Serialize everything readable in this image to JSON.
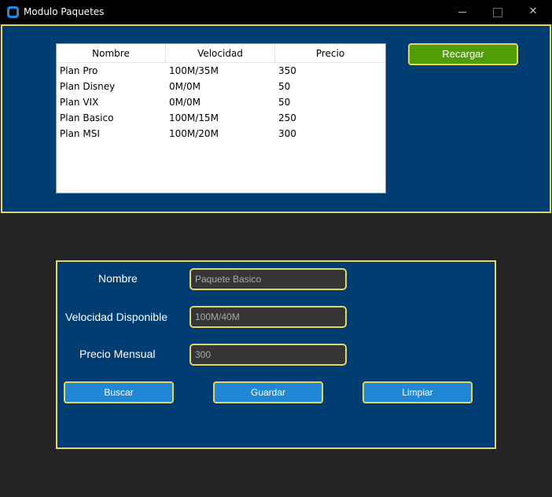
{
  "window": {
    "title": "Modulo Paquetes",
    "controls": {
      "minimize": "minimize",
      "maximize": "maximize",
      "close": "✕"
    }
  },
  "table": {
    "columns": [
      "Nombre",
      "Velocidad",
      "Precio"
    ],
    "rows": [
      [
        "Plan Pro",
        "100M/35M",
        "350"
      ],
      [
        "Plan Disney",
        "0M/0M",
        "50"
      ],
      [
        "Plan VIX",
        "0M/0M",
        "50"
      ],
      [
        "Plan Basico",
        "100M/15M",
        "250"
      ],
      [
        "Plan MSI",
        "100M/20M",
        "300"
      ]
    ]
  },
  "reload_button": "Recargar",
  "form": {
    "nombre_label": "Nombre",
    "nombre_value": "Paquete Basico",
    "velocidad_label": "Velocidad Disponible",
    "velocidad_value": "100M/40M",
    "precio_label": "Precio Mensual",
    "precio_value": "300"
  },
  "buttons": {
    "buscar": "Buscar",
    "guardar": "Guardar",
    "limpiar": "Limpiar"
  },
  "colors": {
    "frame_background": "#003d73",
    "frame_border": "#e8d55a",
    "reload_button": "#4f9e05",
    "action_button": "#1f87d6",
    "input_background": "#343638",
    "app_background": "#242424"
  }
}
